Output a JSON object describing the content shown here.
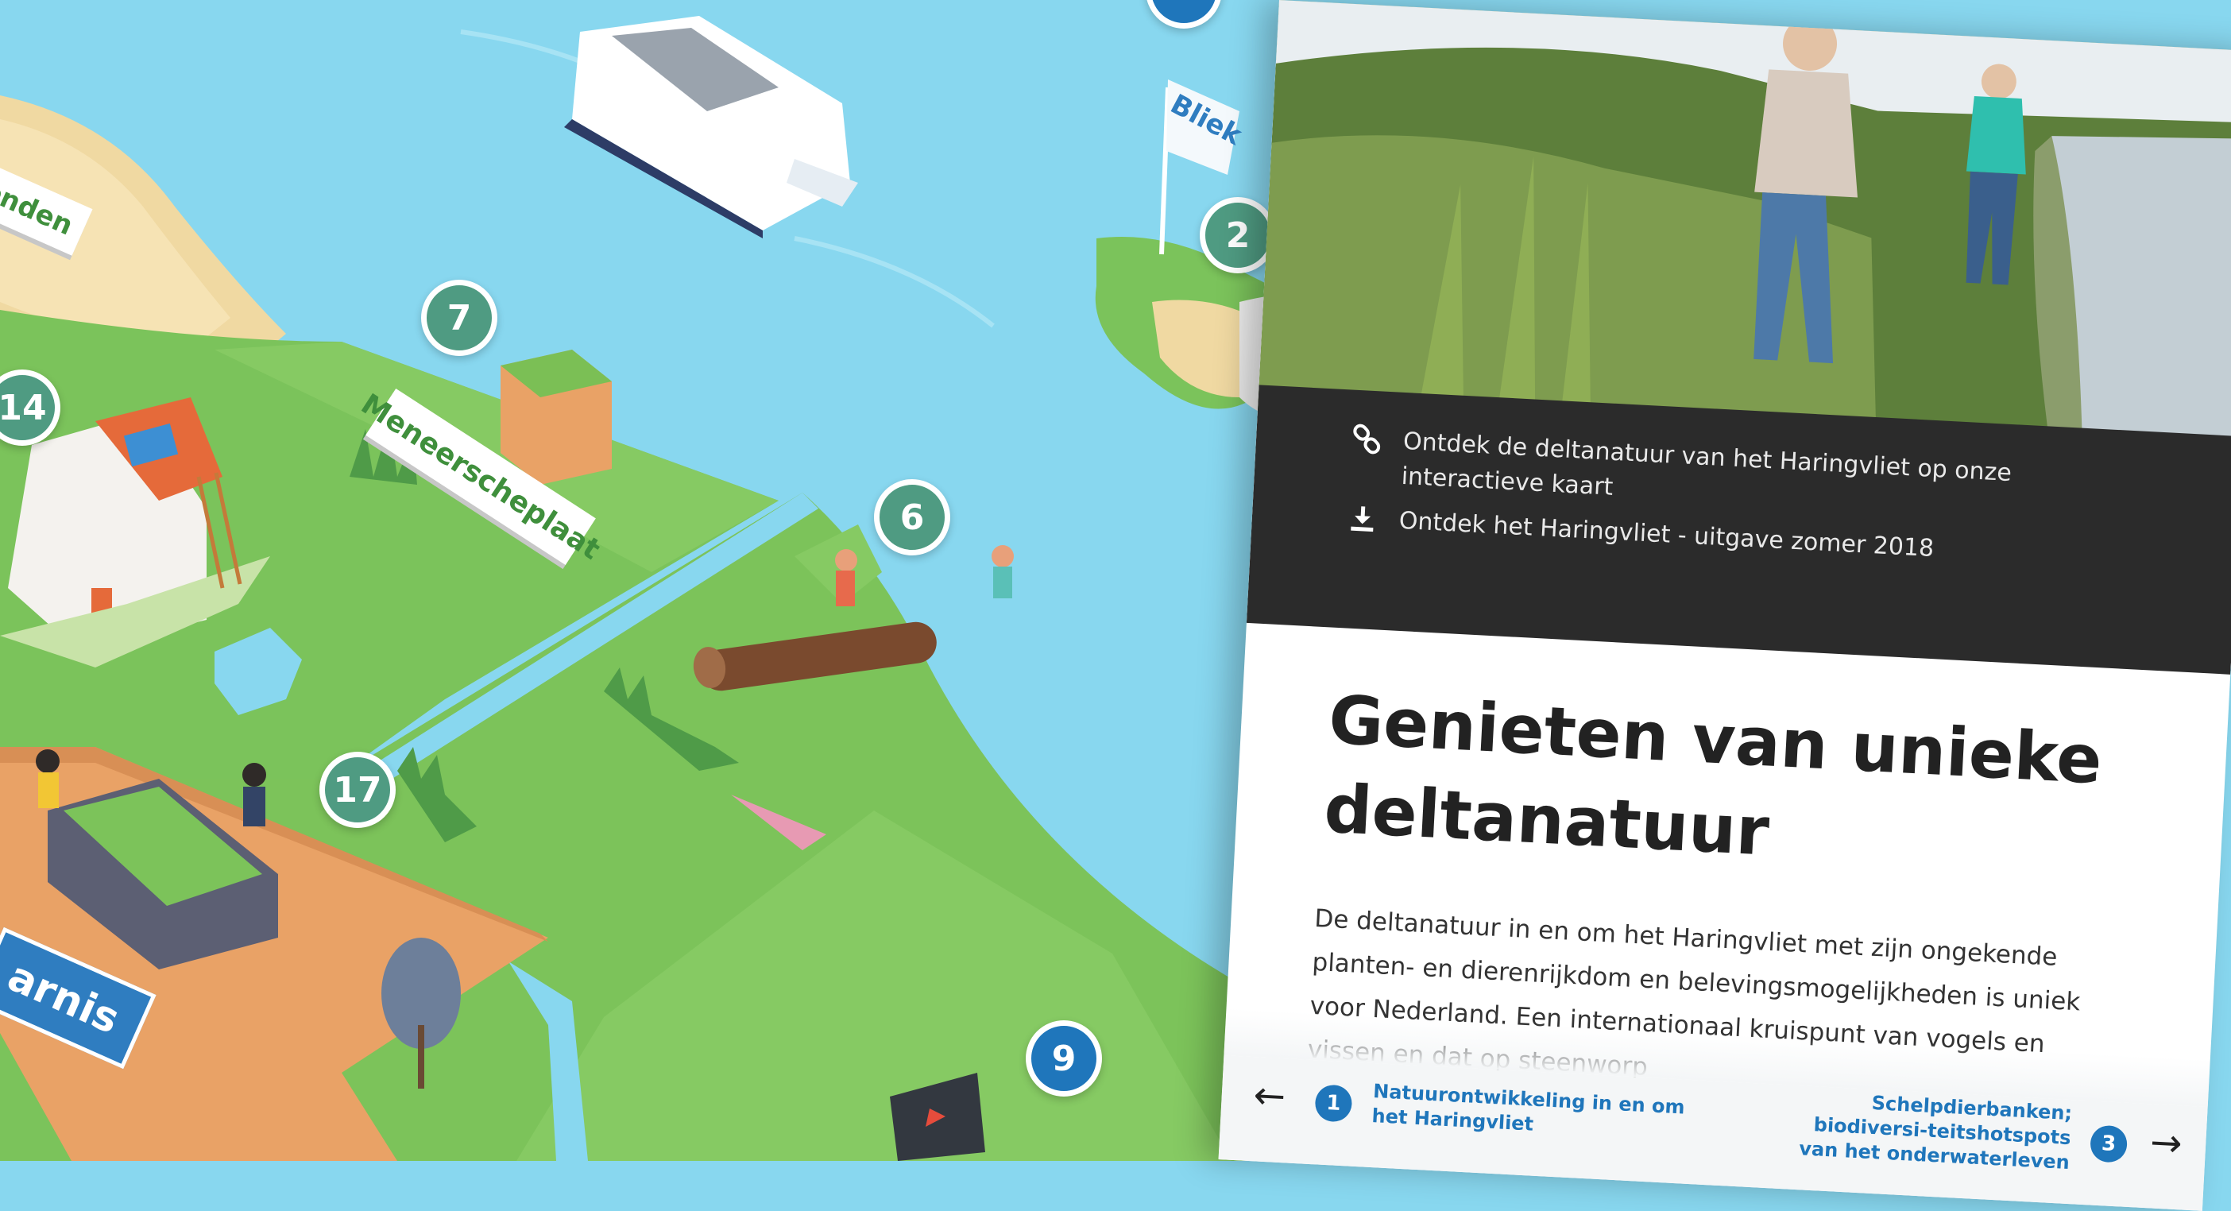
{
  "map": {
    "markers": [
      {
        "number": "7"
      },
      {
        "number": "14"
      },
      {
        "number": "2"
      },
      {
        "number": "6"
      },
      {
        "number": "17"
      },
      {
        "number": "9"
      }
    ],
    "signs": {
      "meneerscheplaat": "Meneerscheplaat",
      "onden": "onden",
      "harnis": "arnis",
      "bliek": "Bliek"
    }
  },
  "panel": {
    "links": [
      {
        "icon": "link-icon",
        "label": "Ontdek de deltanatuur van het Haringvliet op onze interactieve kaart"
      },
      {
        "icon": "download-icon",
        "label": "Ontdek het Haringvliet - uitgave zomer 2018"
      }
    ],
    "title": "Genieten van unieke deltanatuur",
    "body": "De deltanatuur in en om het Haringvliet met zijn ongekende planten- en dierenrijkdom en belevingsmogelijkheden is uniek voor Nederland. Een internationaal kruispunt van vogels en vissen en dat op steenworp",
    "nav": {
      "prev": {
        "number": "1",
        "label": "Natuurontwikkeling in en om het Haringvliet"
      },
      "next": {
        "number": "3",
        "label": "Schelpdierbanken; biodiversi-teitshotspots van het onderwaterleven"
      }
    }
  }
}
